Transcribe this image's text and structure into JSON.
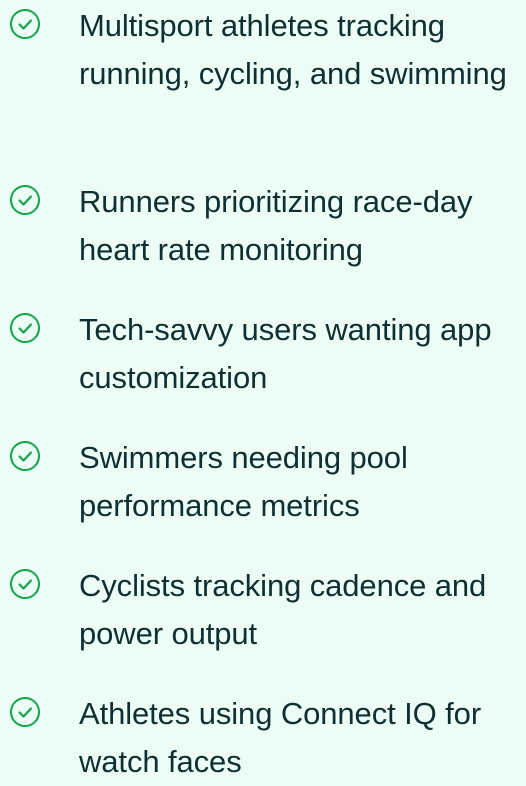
{
  "theme": {
    "background": "#ecfdf5",
    "accent": "#16a34a",
    "text": "#0f2f31"
  },
  "features": {
    "icon": "check-circle-icon",
    "items": [
      {
        "label": "Multisport athletes tracking running, cycling, and swimming"
      },
      {
        "label": "Runners prioritizing race-day heart rate monitoring"
      },
      {
        "label": "Tech-savvy users wanting app customization"
      },
      {
        "label": "Swimmers needing pool performance metrics"
      },
      {
        "label": "Cyclists tracking cadence and power output"
      },
      {
        "label": "Athletes using Connect IQ for watch faces"
      }
    ]
  }
}
